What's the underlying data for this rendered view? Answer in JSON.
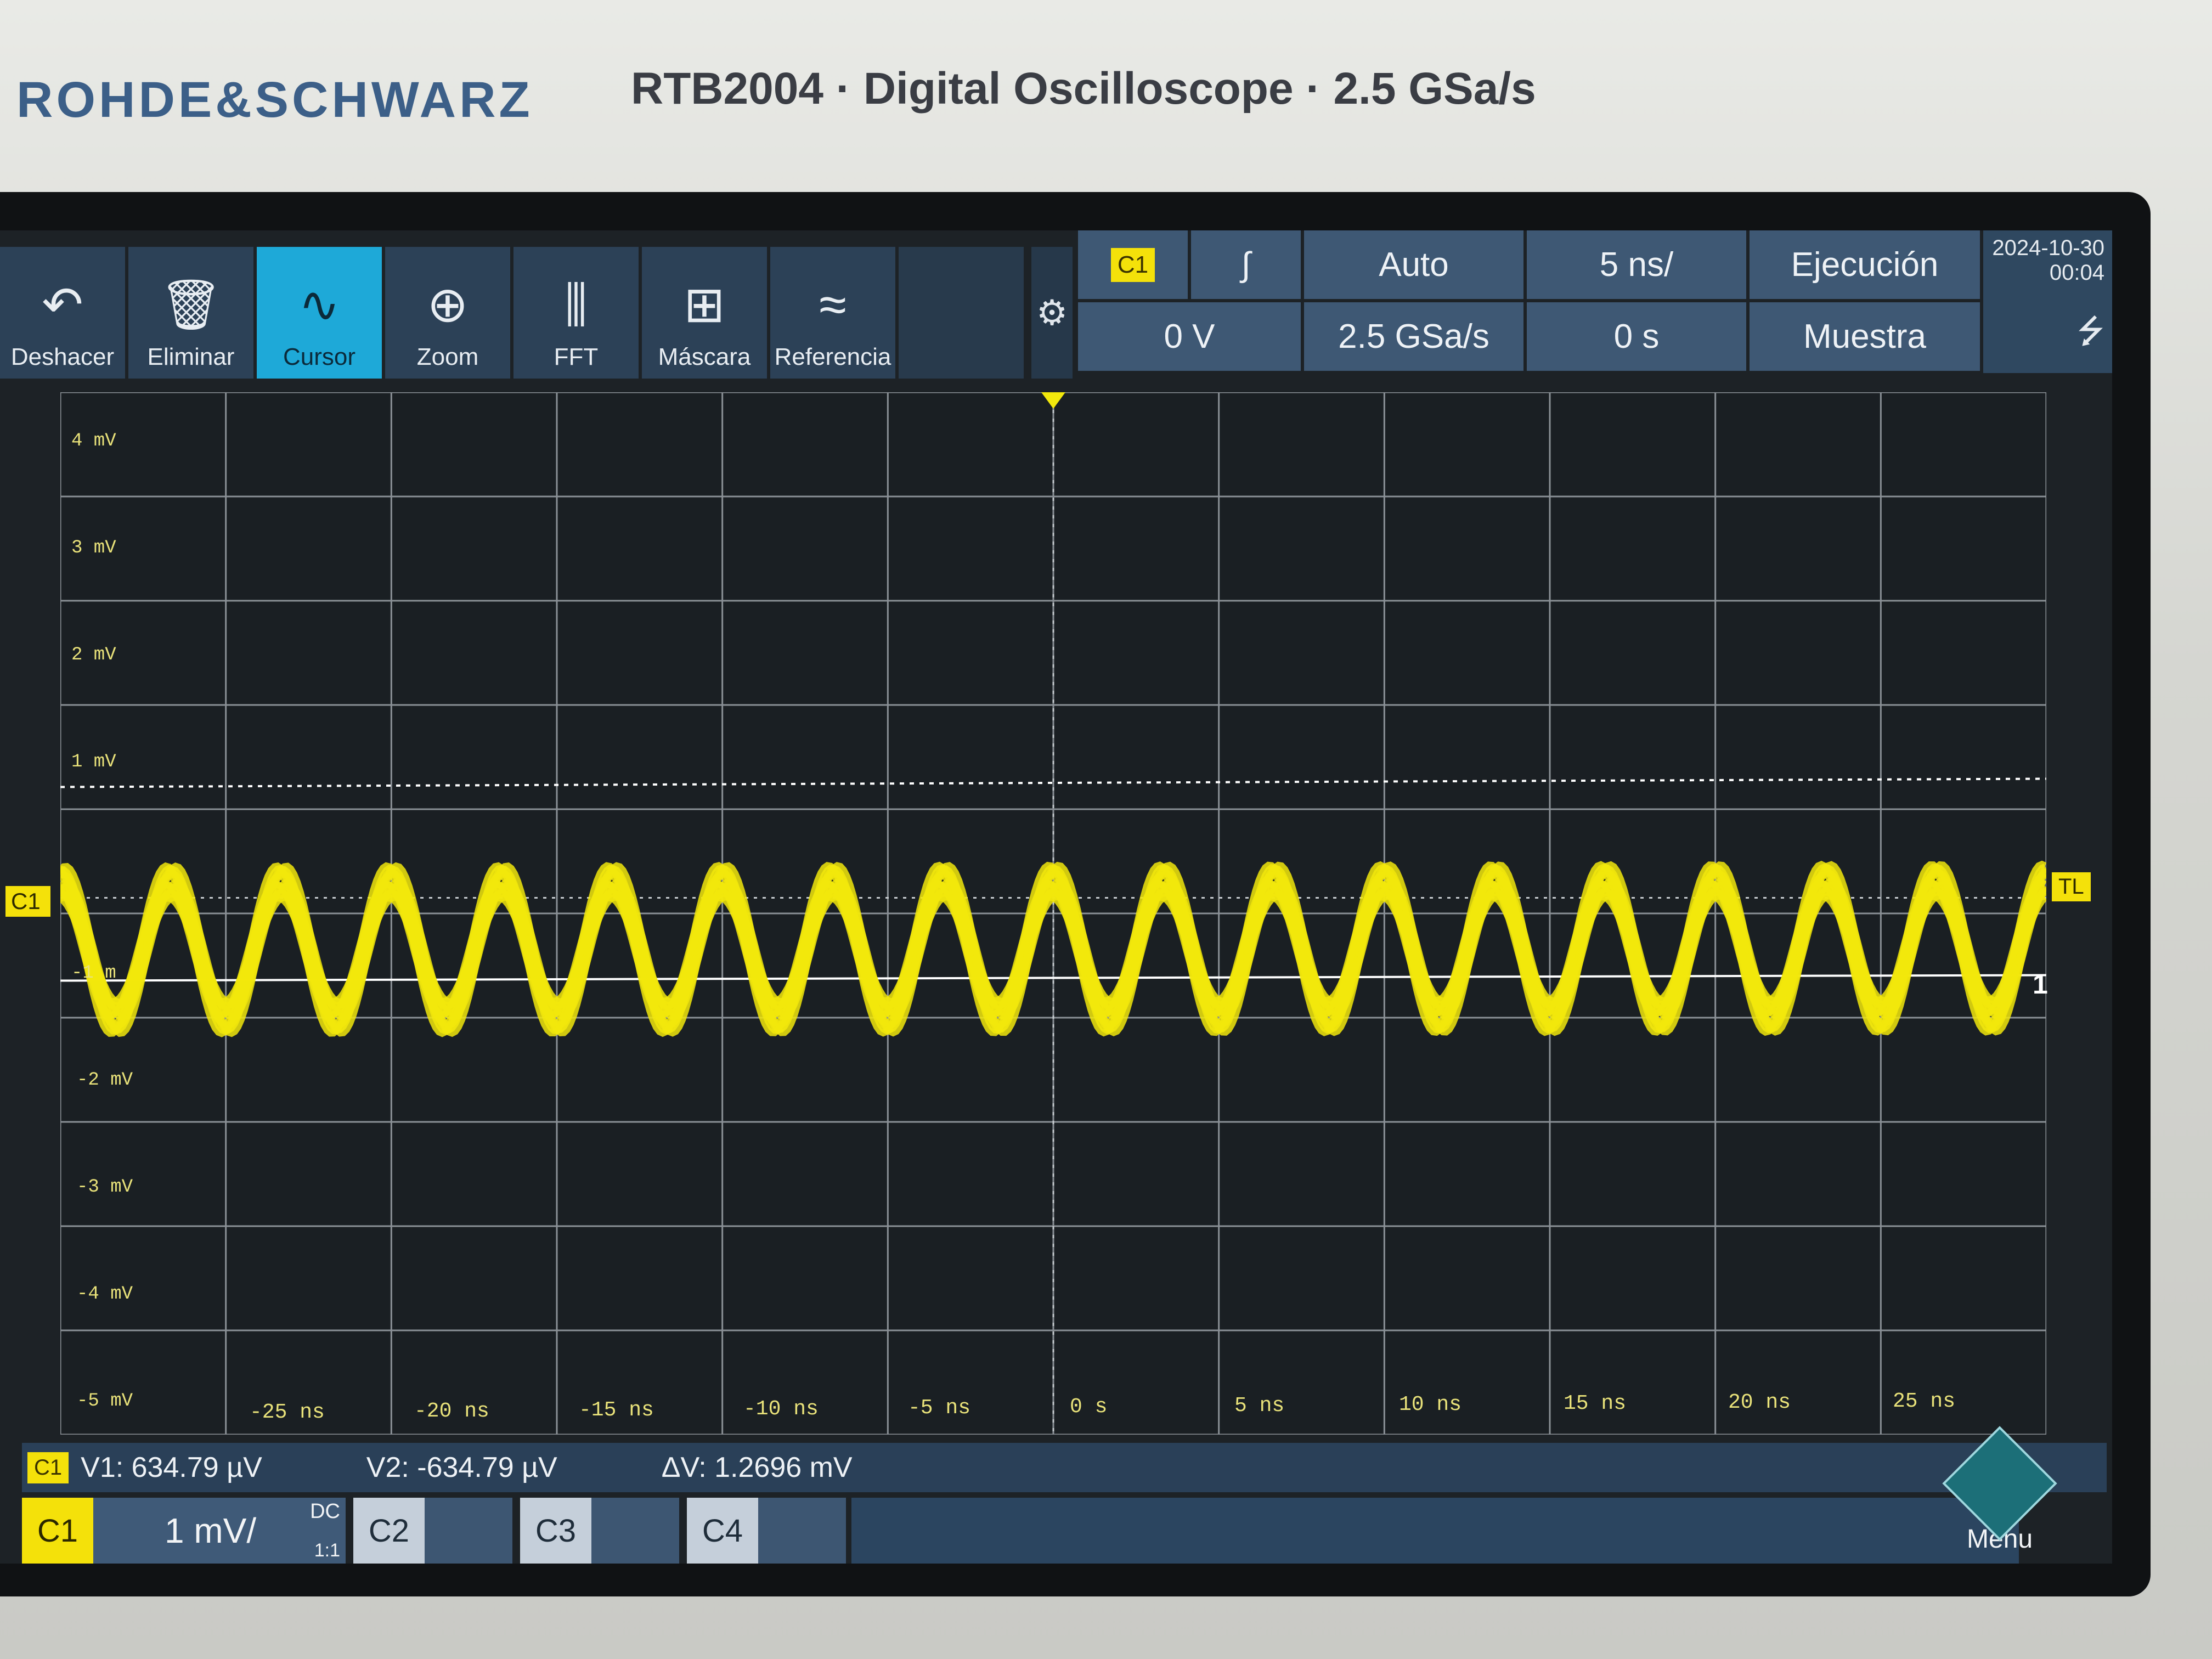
{
  "device": {
    "brand": "ROHDE&SCHWARZ",
    "model_line": "RTB2004 · Digital Oscilloscope · 2.5 GSa/s"
  },
  "toolbar": {
    "items": [
      {
        "label": "Deshacer",
        "icon": "undo-icon"
      },
      {
        "label": "Eliminar",
        "icon": "trash-icon"
      },
      {
        "label": "Cursor",
        "icon": "cursor-wave-icon",
        "active": true
      },
      {
        "label": "Zoom",
        "icon": "zoom-icon"
      },
      {
        "label": "FFT",
        "icon": "fft-icon"
      },
      {
        "label": "Máscara",
        "icon": "mask-icon"
      },
      {
        "label": "Referencia",
        "icon": "reference-icon"
      }
    ]
  },
  "status": {
    "trigger_source": "C1",
    "trigger_slope_symbol": "∫",
    "trigger_level": "0 V",
    "trigger_mode": "Auto",
    "sample_rate": "2.5 GSa/s",
    "time_per_div": "5 ns/",
    "time_offset": "0 s",
    "run_state": "Ejecución",
    "acquisition": "Muestra",
    "date": "2024-10-30",
    "time": "00:04"
  },
  "plot": {
    "y_labels": [
      "4 mV",
      "3 mV",
      "2 mV",
      "1 mV",
      "-1 m",
      "-2 mV",
      "-3 mV",
      "-4 mV",
      "-5 mV"
    ],
    "x_labels": [
      "-25 ns",
      "-20 ns",
      "-15 ns",
      "-10 ns",
      "-5 ns",
      "0 s",
      "5 ns",
      "10 ns",
      "15 ns",
      "20 ns",
      "25 ns"
    ],
    "channel_marker": "C1",
    "trigger_level_marker": "TL",
    "cursor1_label": "1",
    "trace_color": "#f2e80c",
    "cycles_visible": 18
  },
  "readout": {
    "channel": "C1",
    "v1": "V1: 634.79 µV",
    "v2": "V2: -634.79 µV",
    "dv": "ΔV: 1.2696 mV"
  },
  "channels": {
    "c1": "C1",
    "c1_scale": "1 mV/",
    "c1_coupling": "DC",
    "c1_ratio": "1:1",
    "c2": "C2",
    "c3": "C3",
    "c4": "C4"
  },
  "menu": {
    "label": "Menu"
  }
}
